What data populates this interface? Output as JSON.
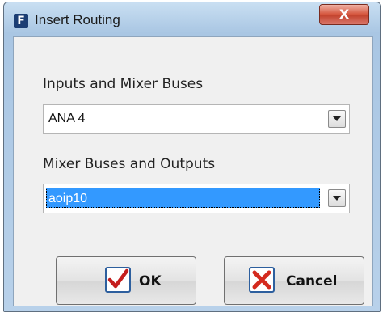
{
  "window": {
    "app_icon_letter": "F",
    "title": "Insert Routing",
    "close_glyph": "X"
  },
  "inputs": {
    "label": "Inputs and Mixer Buses",
    "selected_value": "ANA 4"
  },
  "outputs": {
    "label": "Mixer Buses and Outputs",
    "selected_value": "aoip10"
  },
  "buttons": {
    "ok_label": "OK",
    "cancel_label": "Cancel"
  },
  "colors": {
    "selection": "#3399ff",
    "ok_check": "#c41e1e",
    "cancel_x": "#d42a1e"
  }
}
